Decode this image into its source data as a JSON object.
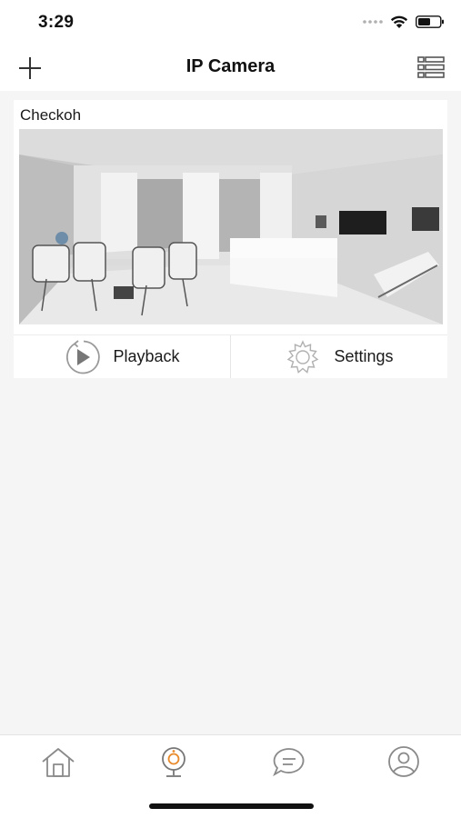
{
  "status_bar": {
    "time": "3:29",
    "icons": [
      "signal-dots-icon",
      "wifi-icon",
      "battery-icon"
    ]
  },
  "header": {
    "title": "IP Camera",
    "left_icon": "plus-icon",
    "right_icon": "list-view-icon"
  },
  "camera": {
    "name": "Checkoh",
    "preview": "live-preview-image",
    "actions": [
      {
        "label": "Playback",
        "icon": "playback-icon"
      },
      {
        "label": "Settings",
        "icon": "settings-gear-icon"
      }
    ]
  },
  "tab_bar": {
    "tabs": [
      {
        "icon": "home-icon",
        "active": false
      },
      {
        "icon": "camera-icon",
        "active": true
      },
      {
        "icon": "message-icon",
        "active": false
      },
      {
        "icon": "profile-icon",
        "active": false
      }
    ],
    "active_color": "#e8892a",
    "inactive_color": "#8a8a8a"
  },
  "colors": {
    "background": "#f5f5f5",
    "surface": "#ffffff",
    "text": "#111111"
  }
}
